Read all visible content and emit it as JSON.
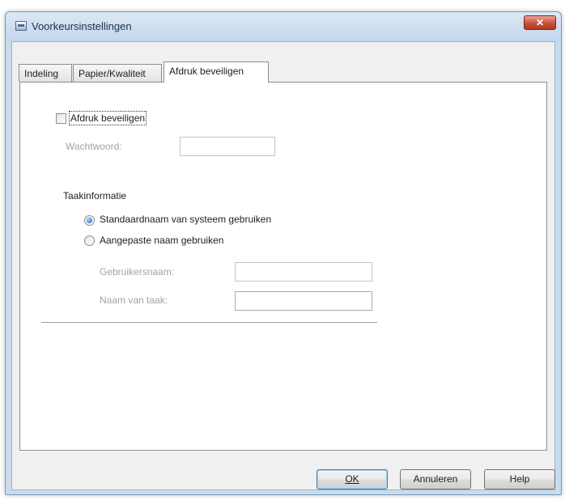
{
  "window": {
    "title": "Voorkeursinstellingen",
    "close_glyph": "✕"
  },
  "tabs": [
    {
      "label": "Indeling",
      "active": false
    },
    {
      "label": "Papier/Kwaliteit",
      "active": false
    },
    {
      "label": "Afdruk beveiligen",
      "active": true
    }
  ],
  "secure_print": {
    "checkbox_label": "Afdruk beveiligen",
    "checked": false,
    "password_label": "Wachtwoord:",
    "password_value": ""
  },
  "job_info": {
    "heading": "Taakinformatie",
    "options": [
      {
        "label": "Standaardnaam van systeem gebruiken",
        "selected": true
      },
      {
        "label": "Aangepaste naam gebruiken",
        "selected": false
      }
    ],
    "username_label": "Gebruikersnaam:",
    "username_value": "",
    "jobname_label": "Naam van taak:",
    "jobname_value": ""
  },
  "buttons": {
    "ok": "OK",
    "cancel": "Annuleren",
    "help": "Help"
  },
  "icons": {
    "app": "printer-settings-icon",
    "close": "close-icon"
  },
  "colors": {
    "titlebar": "#c9dbee",
    "close_button": "#c8503a",
    "disabled_text": "#a3a3a3",
    "radio_selected": "#1f5fb4"
  }
}
